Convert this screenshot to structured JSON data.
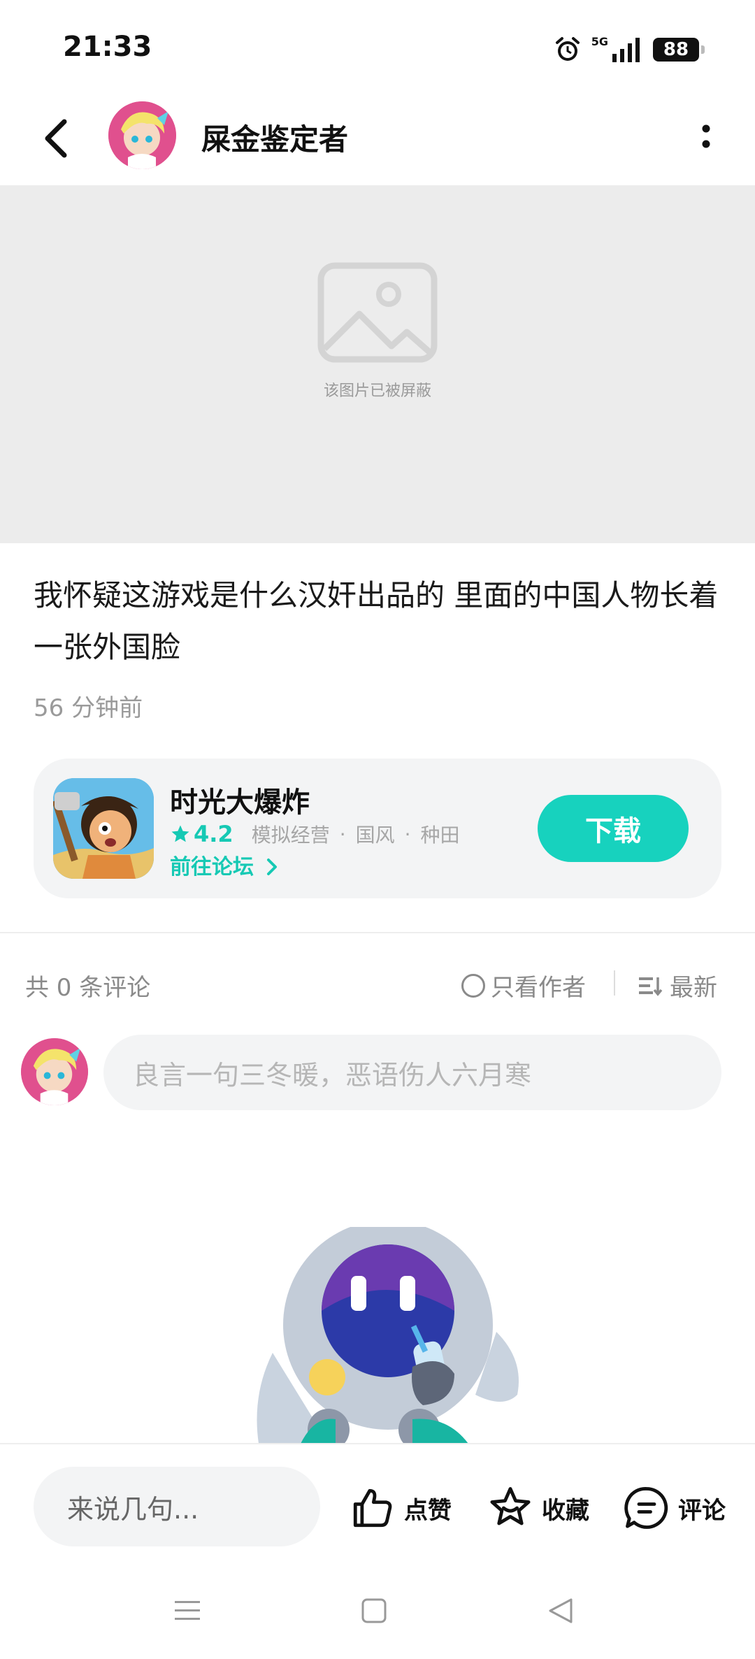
{
  "status_bar": {
    "time": "21:33",
    "network": "5G",
    "battery": "88"
  },
  "header": {
    "author_name": "屎金鉴定者"
  },
  "blocked_image": {
    "text": "该图片已被屏蔽"
  },
  "post": {
    "text": "我怀疑这游戏是什么汉奸出品的 里面的中国人物长着一张外国脸",
    "time": "56 分钟前"
  },
  "game_card": {
    "name": "时光大爆炸",
    "rating": "4.2",
    "tags": [
      "模拟经营",
      "国风",
      "种田"
    ],
    "separator": "·",
    "forum_link": "前往论坛",
    "download_label": "下载",
    "accent_color": "#17d2be"
  },
  "comments": {
    "count_label": "共 0 条评论",
    "author_only_label": "只看作者",
    "sort_label": "最新",
    "input_placeholder": "良言一句三冬暖，恶语伤人六月寒"
  },
  "bottom_bar": {
    "input_placeholder": "来说几句...",
    "like_label": "点赞",
    "favorite_label": "收藏",
    "comment_label": "评论"
  },
  "icons": [
    "back-arrow-icon",
    "more-vertical-icon",
    "image-placeholder-icon",
    "star-icon",
    "chevron-right-icon",
    "radio-circle-icon",
    "sort-icon",
    "thumbs-up-icon",
    "star-outline-icon",
    "comment-bubble-icon",
    "menu-icon",
    "home-square-icon",
    "back-triangle-icon",
    "alarm-icon",
    "signal-icon"
  ]
}
